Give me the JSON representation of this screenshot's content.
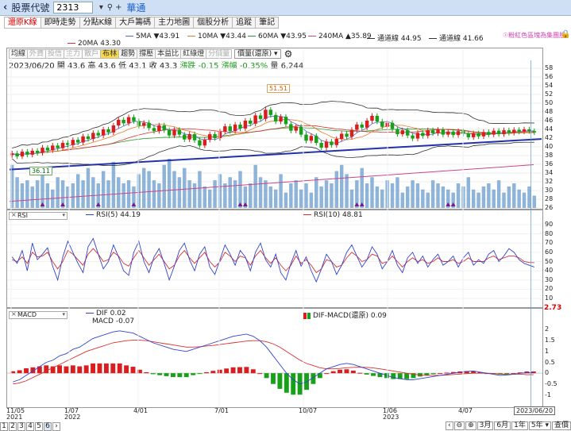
{
  "topbar": {
    "back": "‹",
    "label": "股票代號",
    "stock_code": "2313",
    "stock_name": "華通"
  },
  "tabs": [
    "還原K線",
    "即時走勢",
    "分點K線",
    "大戶籌碼",
    "主力地圖",
    "個股分析",
    "追蹤",
    "筆記"
  ],
  "legend": {
    "ma5": "5MA ▼43.91",
    "ma10": "10MA ▼43.44",
    "ma60": "60MA ▼43.95",
    "ma240": "240MA ▲35.89",
    "upper": "通道線 44.95",
    "lower": "通道線 41.66",
    "ma20": "20MA 43.30",
    "hint": "☉粉紅色區塊為集團股"
  },
  "colors": {
    "ma5": "#5566cc",
    "ma10": "#e87a2a",
    "ma60": "#2a9a2a",
    "ma240": "#cc4488",
    "ma20": "#d83030",
    "up": "#d81e1e",
    "down": "#18a018",
    "vol": "#7aa7d3",
    "trend": "#2233aa"
  },
  "subtools": [
    "均線",
    "外資",
    "投信",
    "主力",
    "散戶",
    "布林",
    "趨勢",
    "撐壓",
    "本益比",
    "紅綠燈",
    "分價量"
  ],
  "subtools_state": [
    "on",
    "dim",
    "dim",
    "dim",
    "dim",
    "on",
    "on",
    "on",
    "on",
    "on",
    "dim"
  ],
  "subtools_select": "價量(還原) ▾",
  "ohlc": {
    "date": "2023/06/20",
    "open": "開 43.6",
    "high": "高 43.6",
    "low": "低 43.1",
    "close": "收 43.3",
    "change": "漲跌 -0.15",
    "pct": "漲幅 -0.35%",
    "volume": "量 6,244"
  },
  "price_labels": {
    "high": "51.51",
    "low": "36.11"
  },
  "price_axis": [
    "58",
    "56",
    "54",
    "52",
    "50",
    "48",
    "46",
    "44",
    "42",
    "40",
    "38",
    "36",
    "34",
    "32",
    "30",
    "28",
    "26"
  ],
  "rsi": {
    "selector": "RSI",
    "rsi5": "RSI(5) 44.19",
    "rsi10": "RSI(10) 48.81",
    "axis": [
      "90",
      "80",
      "70",
      "60",
      "50",
      "40",
      "30",
      "20",
      "10"
    ]
  },
  "macd": {
    "selector": "MACD",
    "dif": "DIF 0.02",
    "macd": "MACD -0.07",
    "osc": "DIF-MACD(還原) 0.09",
    "axis": [
      "2",
      "1.5",
      "1",
      "0.5",
      "0",
      "-0.5",
      "-1"
    ],
    "red_value": "2.73"
  },
  "xaxis": [
    {
      "t": "11/05\n2021"
    },
    {
      "t": "1/07\n2022"
    },
    {
      "t": "4/01"
    },
    {
      "t": "7/01"
    },
    {
      "t": "10/07"
    },
    {
      "t": "1/06\n2023"
    },
    {
      "t": "4/07"
    }
  ],
  "current_date": "2023/06/20",
  "pages": [
    "1",
    "2",
    "3",
    "4",
    "5",
    "6"
  ],
  "nav": [
    "‹",
    "⊖",
    "⊕",
    "3月",
    "6月",
    "1年",
    "5年 ▾",
    "查價"
  ],
  "chart_data": {
    "type": "candlestick",
    "ylim": [
      26,
      58
    ],
    "closes": [
      38.5,
      37.8,
      38.9,
      38.2,
      39.1,
      38.6,
      39.8,
      39.2,
      40.3,
      39.7,
      40.9,
      40.4,
      41.6,
      41.0,
      42.4,
      41.8,
      43.2,
      42.6,
      44.0,
      43.3,
      44.9,
      46.2,
      45.4,
      46.8,
      45.9,
      44.8,
      45.5,
      44.3,
      43.6,
      44.9,
      43.8,
      42.6,
      43.9,
      42.8,
      41.7,
      42.9,
      41.5,
      40.3,
      41.6,
      42.9,
      42.0,
      43.5,
      44.7,
      43.6,
      45.1,
      44.2,
      46.0,
      45.3,
      47.2,
      46.4,
      48.5,
      47.3,
      45.8,
      46.9,
      45.2,
      43.7,
      44.6,
      42.8,
      41.4,
      42.5,
      40.9,
      39.8,
      41.2,
      40.4,
      41.8,
      43.0,
      42.3,
      43.9,
      45.1,
      44.4,
      46.0,
      47.1,
      45.8,
      44.6,
      45.5,
      44.1,
      42.9,
      43.8,
      42.6,
      41.9,
      43.2,
      42.5,
      43.8,
      43.1,
      43.9,
      42.8,
      43.5,
      42.7,
      43.6,
      43.0,
      42.2,
      43.1,
      42.4,
      43.4,
      42.8,
      43.7,
      42.9,
      43.8,
      43.2,
      43.9,
      43.5,
      44.0,
      43.6,
      43.3
    ],
    "volume": [
      14,
      10,
      8,
      9,
      7,
      9,
      12,
      8,
      6,
      10,
      9,
      7,
      8,
      11,
      9,
      13,
      10,
      8,
      12,
      9,
      15,
      10,
      8,
      9,
      7,
      11,
      13,
      12,
      9,
      8,
      14,
      16,
      12,
      10,
      13,
      9,
      8,
      12,
      7,
      6,
      9,
      11,
      8,
      10,
      9,
      12,
      7,
      8,
      14,
      10,
      9,
      7,
      6,
      11,
      5,
      8,
      9,
      6,
      8,
      5,
      10,
      7,
      9,
      8,
      12,
      14,
      11,
      6,
      9,
      13,
      8,
      10,
      7,
      6,
      9,
      8,
      10,
      5,
      7,
      9,
      8,
      6,
      5,
      9,
      8,
      7,
      6,
      5,
      8,
      7,
      10,
      6,
      5,
      7,
      8,
      6,
      9,
      5,
      7,
      8,
      6,
      5,
      7,
      4
    ],
    "rsi5": [
      55,
      48,
      62,
      40,
      70,
      52,
      58,
      65,
      45,
      30,
      55,
      72,
      60,
      48,
      38,
      66,
      75,
      58,
      42,
      50,
      68,
      55,
      40,
      35,
      60,
      72,
      50,
      38,
      55,
      64,
      48,
      30,
      45,
      62,
      70,
      52,
      40,
      58,
      66,
      44,
      36,
      52,
      68,
      58,
      46,
      62,
      55,
      40,
      60,
      70,
      52,
      44,
      58,
      38,
      30,
      48,
      62,
      45,
      55,
      40,
      28,
      42,
      58,
      50,
      36,
      46,
      60,
      68,
      56,
      44,
      52,
      66,
      58,
      42,
      50,
      62,
      46,
      38,
      54,
      60,
      48,
      56,
      44,
      52,
      58,
      46,
      50,
      56,
      44,
      54,
      60,
      46,
      52,
      48,
      58,
      62,
      50,
      56,
      64,
      60,
      52,
      48,
      46,
      44
    ],
    "rsi10": [
      52,
      50,
      55,
      48,
      60,
      55,
      56,
      60,
      50,
      42,
      50,
      62,
      58,
      52,
      46,
      58,
      64,
      58,
      50,
      52,
      60,
      56,
      48,
      45,
      54,
      62,
      54,
      46,
      52,
      58,
      50,
      42,
      46,
      56,
      62,
      54,
      48,
      54,
      60,
      50,
      44,
      50,
      60,
      56,
      50,
      56,
      54,
      46,
      56,
      62,
      54,
      48,
      54,
      46,
      40,
      46,
      56,
      48,
      52,
      46,
      38,
      42,
      52,
      50,
      44,
      46,
      54,
      60,
      56,
      50,
      52,
      58,
      56,
      48,
      50,
      56,
      50,
      44,
      50,
      54,
      50,
      52,
      48,
      50,
      54,
      50,
      50,
      52,
      48,
      50,
      54,
      50,
      50,
      50,
      54,
      56,
      52,
      54,
      56,
      56,
      54,
      50,
      49,
      48.8
    ],
    "dif": [
      -0.4,
      -0.3,
      -0.1,
      0.1,
      0.3,
      0.5,
      0.6,
      0.8,
      0.9,
      1.1,
      1.2,
      1.4,
      1.6,
      1.7,
      1.8,
      1.9,
      1.95,
      1.9,
      1.85,
      1.7,
      1.55,
      1.4,
      1.3,
      1.2,
      1.1,
      1.05,
      1.0,
      1.1,
      1.2,
      1.3,
      1.4,
      1.5,
      1.6,
      1.7,
      1.75,
      1.8,
      1.7,
      1.5,
      1.2,
      0.8,
      0.4,
      0.0,
      -0.3,
      -0.5,
      -0.4,
      -0.2,
      0.0,
      0.2,
      0.3,
      0.4,
      0.45,
      0.4,
      0.3,
      0.2,
      0.1,
      0.0,
      -0.1,
      -0.2,
      -0.25,
      -0.3,
      -0.3,
      -0.25,
      -0.2,
      -0.15,
      -0.1,
      -0.05,
      0.0,
      0.05,
      0.08,
      0.1,
      0.05,
      0.0,
      -0.05,
      -0.1,
      -0.08,
      -0.05,
      0.0,
      0.02,
      0.02
    ],
    "macd": [
      -0.5,
      -0.45,
      -0.35,
      -0.2,
      -0.05,
      0.1,
      0.25,
      0.4,
      0.55,
      0.7,
      0.85,
      1.0,
      1.1,
      1.2,
      1.3,
      1.4,
      1.45,
      1.5,
      1.52,
      1.52,
      1.5,
      1.45,
      1.4,
      1.35,
      1.3,
      1.25,
      1.2,
      1.2,
      1.22,
      1.25,
      1.28,
      1.32,
      1.36,
      1.4,
      1.44,
      1.48,
      1.5,
      1.5,
      1.45,
      1.35,
      1.2,
      1.0,
      0.8,
      0.6,
      0.45,
      0.35,
      0.25,
      0.2,
      0.2,
      0.22,
      0.25,
      0.27,
      0.28,
      0.27,
      0.24,
      0.2,
      0.15,
      0.1,
      0.05,
      0.0,
      -0.05,
      -0.08,
      -0.1,
      -0.1,
      -0.1,
      -0.08,
      -0.06,
      -0.04,
      -0.02,
      0.0,
      0.0,
      0.0,
      -0.02,
      -0.04,
      -0.05,
      -0.05,
      -0.04,
      -0.07,
      -0.07
    ]
  }
}
